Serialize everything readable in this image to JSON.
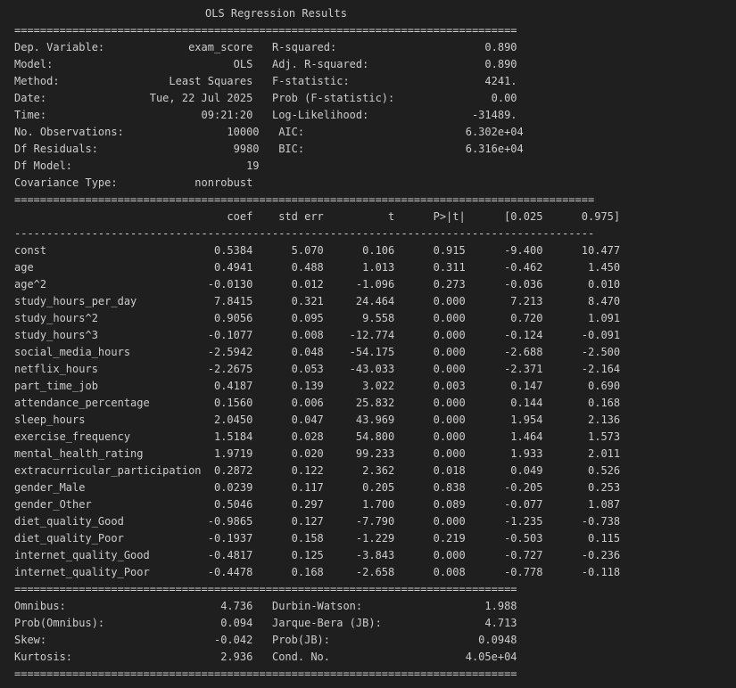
{
  "title": "OLS Regression Results",
  "separators": {
    "top_double": "==============================================================================",
    "coef_double": "==========================================================================================",
    "coef_dash": "------------------------------------------------------------------------------------------",
    "coef_bottom_double": "==========================================================================================",
    "diag_double": "==============================================================================",
    "diag_bottom_double": "=============================================================================="
  },
  "summary_rows": [
    "Dep. Variable:             exam_score   R-squared:                       0.890",
    "Model:                            OLS   Adj. R-squared:                  0.890",
    "Method:                 Least Squares   F-statistic:                     4241.",
    "Date:                Tue, 22 Jul 2025   Prob (F-statistic):               0.00",
    "Time:                        09:21:20   Log-Likelihood:                -31489.",
    "No. Observations:                10000   AIC:                         6.302e+04",
    "Df Residuals:                     9980   BIC:                         6.316e+04",
    "Df Model:                           19                                         ",
    "Covariance Type:            nonrobust                                         "
  ],
  "coef_header": "                                 coef    std err          t      P>|t|      [0.025      0.975]",
  "coef_rows": [
    "const                          0.5384      5.070      0.106      0.915      -9.400      10.477",
    "age                            0.4941      0.488      1.013      0.311      -0.462       1.450",
    "age^2                         -0.0130      0.012     -1.096      0.273      -0.036       0.010",
    "study_hours_per_day            7.8415      0.321     24.464      0.000       7.213       8.470",
    "study_hours^2                  0.9056      0.095      9.558      0.000       0.720       1.091",
    "study_hours^3                 -0.1077      0.008    -12.774      0.000      -0.124      -0.091",
    "social_media_hours            -2.5942      0.048    -54.175      0.000      -2.688      -2.500",
    "netflix_hours                 -2.2675      0.053    -43.033      0.000      -2.371      -2.164",
    "part_time_job                  0.4187      0.139      3.022      0.003       0.147       0.690",
    "attendance_percentage          0.1560      0.006     25.832      0.000       0.144       0.168",
    "sleep_hours                    2.0450      0.047     43.969      0.000       1.954       2.136",
    "exercise_frequency             1.5184      0.028     54.800      0.000       1.464       1.573",
    "mental_health_rating           1.9719      0.020     99.233      0.000       1.933       2.011",
    "extracurricular_participation  0.2872      0.122      2.362      0.018       0.049       0.526",
    "gender_Male                    0.0239      0.117      0.205      0.838      -0.205       0.253",
    "gender_Other                   0.5046      0.297      1.700      0.089      -0.077       1.087",
    "diet_quality_Good             -0.9865      0.127     -7.790      0.000      -1.235      -0.738",
    "diet_quality_Poor             -0.1937      0.158     -1.229      0.219      -0.503       0.115",
    "internet_quality_Good         -0.4817      0.125     -3.843      0.000      -0.727      -0.236",
    "internet_quality_Poor         -0.4478      0.168     -2.658      0.008      -0.778      -0.118"
  ],
  "diag_rows": [
    "Omnibus:                        4.736   Durbin-Watson:                   1.988",
    "Prob(Omnibus):                  0.094   Jarque-Bera (JB):                4.713",
    "Skew:                          -0.042   Prob(JB):                       0.0948",
    "Kurtosis:                       2.936   Cond. No.                     4.05e+04"
  ]
}
